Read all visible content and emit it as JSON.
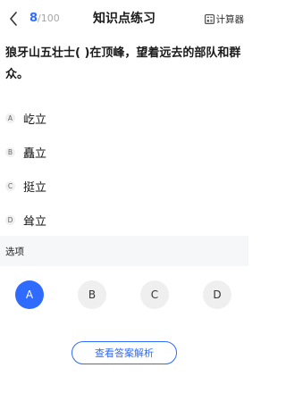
{
  "header": {
    "current": "8",
    "slash": "/",
    "total": "100",
    "title": "知识点练习",
    "calculator_label": "计算器"
  },
  "question": {
    "text": "狼牙山五壮士( )在顶峰，望着远去的部队和群众。"
  },
  "options": [
    {
      "letter": "A",
      "text": "屹立"
    },
    {
      "letter": "B",
      "text": "矗立"
    },
    {
      "letter": "C",
      "text": "挺立"
    },
    {
      "letter": "D",
      "text": "耸立"
    }
  ],
  "answer_section": {
    "label": "选项",
    "choices": [
      "A",
      "B",
      "C",
      "D"
    ],
    "selected": "A"
  },
  "analysis_button": {
    "label": "查看答案解析"
  },
  "colors": {
    "accent": "#2f6bff",
    "muted": "#a6a6a6",
    "section_bg": "#f6f7f9"
  }
}
